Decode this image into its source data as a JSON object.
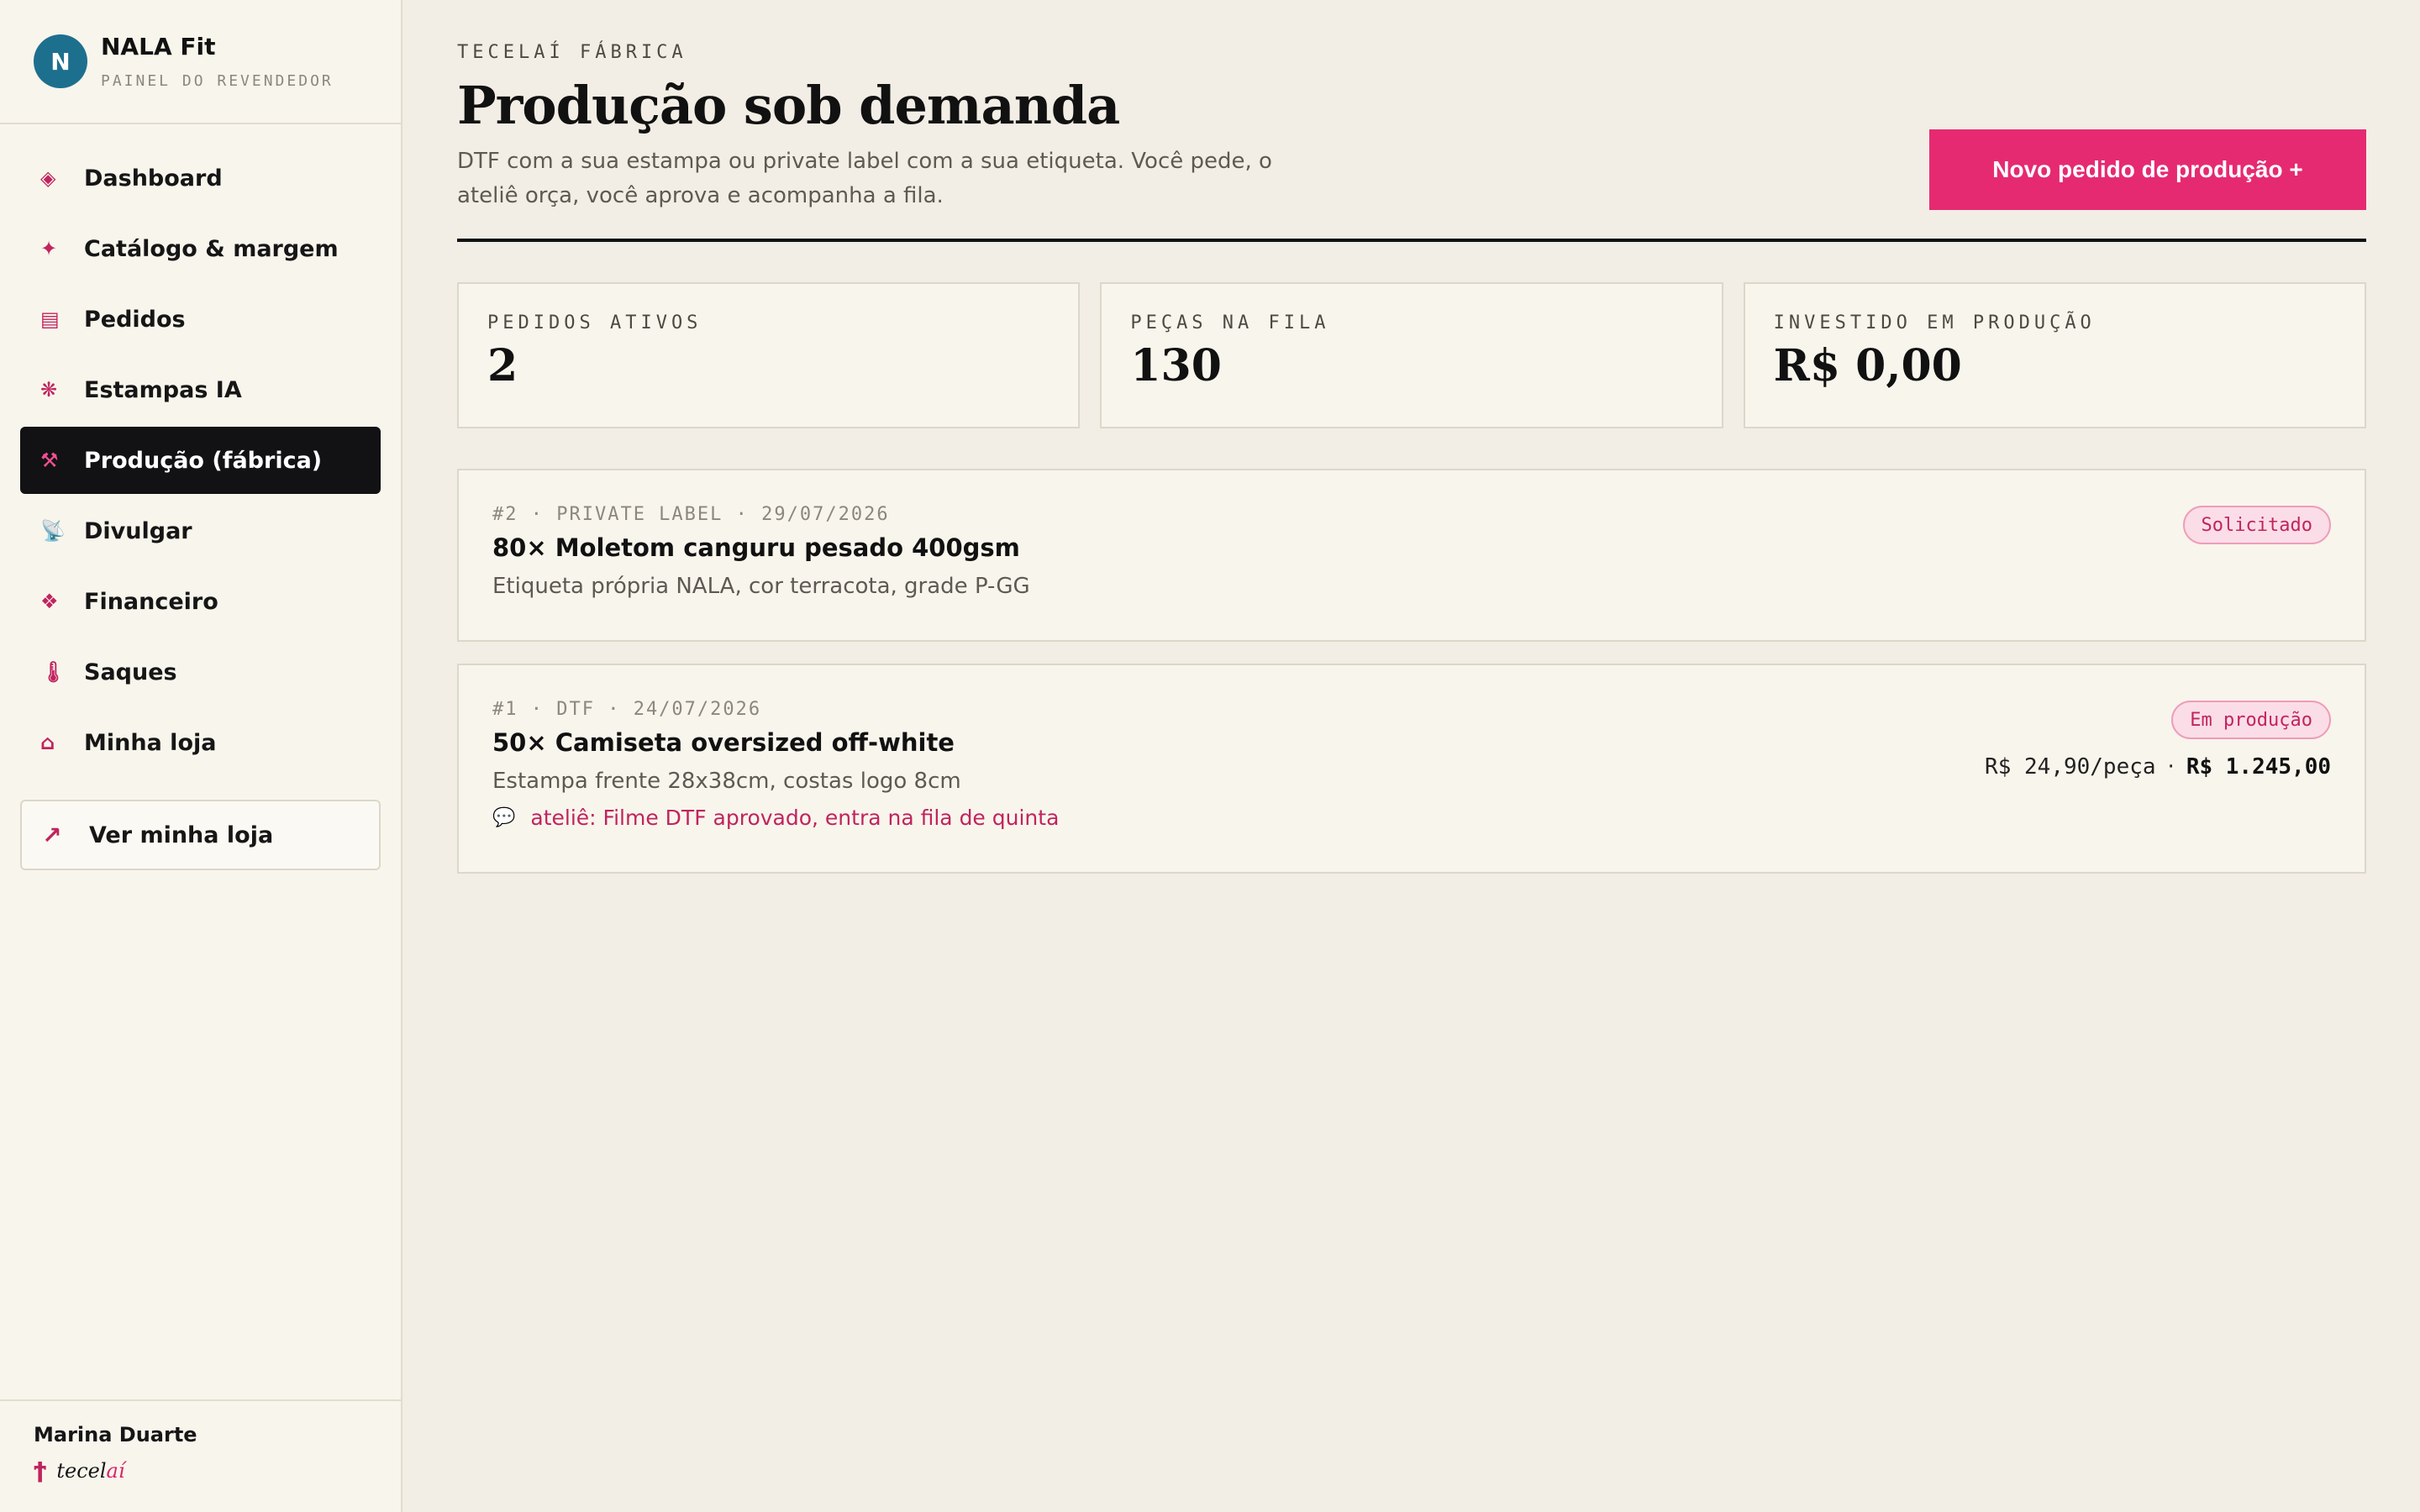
{
  "brand": {
    "avatar_initial": "N",
    "name": "NALA Fit",
    "subtitle": "PAINEL DO REVENDEDOR"
  },
  "sidebar": {
    "items": [
      {
        "label": "Dashboard",
        "icon": "diamond-outline-icon",
        "glyph": "◈",
        "active": false
      },
      {
        "label": "Catálogo & margem",
        "icon": "sparkle-icon",
        "glyph": "✦",
        "active": false
      },
      {
        "label": "Pedidos",
        "icon": "list-icon",
        "glyph": "▤",
        "active": false
      },
      {
        "label": "Estampas IA",
        "icon": "asterisk-flower-icon",
        "glyph": "❋",
        "active": false
      },
      {
        "label": "Produção (fábrica)",
        "icon": "hammer-pick-icon",
        "glyph": "⚒",
        "active": true
      },
      {
        "label": "Divulgar",
        "icon": "satellite-dish-icon",
        "glyph": "📡",
        "active": false
      },
      {
        "label": "Financeiro",
        "icon": "diamond-cluster-icon",
        "glyph": "❖",
        "active": false
      },
      {
        "label": "Saques",
        "icon": "thermometer-icon",
        "glyph": "🌡",
        "active": false
      },
      {
        "label": "Minha loja",
        "icon": "house-icon",
        "glyph": "⌂",
        "active": false
      }
    ],
    "view_store": {
      "label": "Ver minha loja",
      "icon": "arrow-up-right-icon",
      "glyph": "↗"
    }
  },
  "user": {
    "name": "Marina Duarte",
    "logo_mark": "ϯ",
    "logo_text_a": "tecel",
    "logo_text_b": "aí"
  },
  "header": {
    "eyebrow": "TECELAÍ FÁBRICA",
    "title": "Produção sob demanda",
    "description": "DTF com a sua estampa ou private label com a sua etiqueta. Você pede, o ateliê orça, você aprova e acompanha a fila.",
    "new_order_button": "Novo pedido de produção +"
  },
  "stats": [
    {
      "label": "PEDIDOS ATIVOS",
      "value": "2"
    },
    {
      "label": "PEÇAS NA FILA",
      "value": "130"
    },
    {
      "label": "INVESTIDO EM PRODUÇÃO",
      "value": "R$ 0,00"
    }
  ],
  "orders": [
    {
      "meta": "#2 · PRIVATE LABEL · 29/07/2026",
      "title": "80× Moletom canguru pesado 400gsm",
      "description": "Etiqueta própria NALA, cor terracota, grade P-GG",
      "status": "Solicitado"
    },
    {
      "meta": "#1 · DTF · 24/07/2026",
      "title": "50× Camiseta oversized off-white",
      "description": "Estampa frente 28x38cm, costas logo 8cm",
      "note": "ateliê: Filme DTF aprovado, entra na fila de quinta",
      "note_icon": "speech-bubble-icon",
      "status": "Em produção",
      "unit_price": "R$ 24,90/peça",
      "separator": "·",
      "total": "R$ 1.245,00"
    }
  ],
  "colors": {
    "accent": "#e62a72",
    "dark": "#121114",
    "avatar": "#1d6f8e",
    "background": "#f2ede5"
  }
}
